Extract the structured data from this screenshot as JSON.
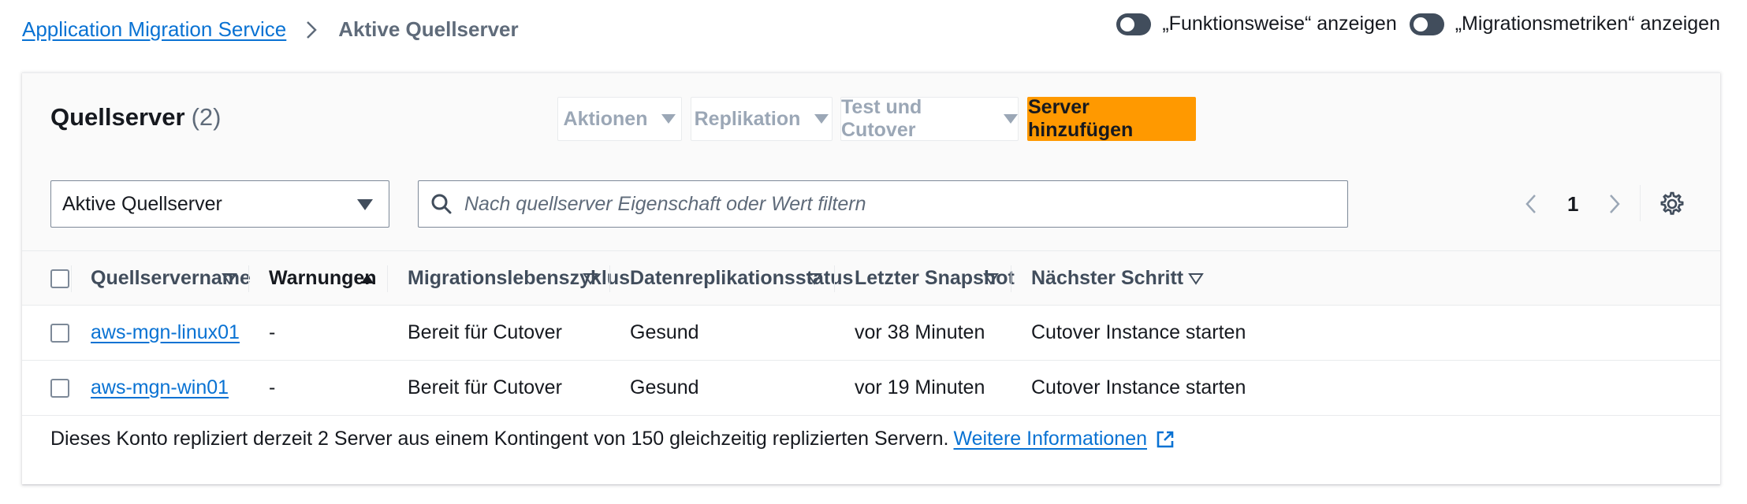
{
  "breadcrumb": {
    "root": "Application Migration Service",
    "current": "Aktive Quellserver"
  },
  "toggles": [
    {
      "label": "„Funktionsweise“ anzeigen",
      "on": false
    },
    {
      "label": "„Migrationsmetriken“ anzeigen",
      "on": false
    }
  ],
  "panel": {
    "title": "Quellserver",
    "count": "(2)"
  },
  "buttons": {
    "actions": "Aktionen",
    "replication": "Replikation",
    "test_cutover": "Test und Cutover",
    "add_server": "Server hinzufügen"
  },
  "filter": {
    "selected": "Aktive Quellserver",
    "search_placeholder": "Nach quellserver Eigenschaft oder Wert filtern"
  },
  "pagination": {
    "current_page": "1"
  },
  "table": {
    "columns": [
      "Quellservername",
      "Warnungen",
      "Migrationslebenszyklus",
      "Datenreplikationsstatus",
      "Letzter Snapshot",
      "Nächster Schritt"
    ],
    "rows": [
      {
        "name": "aws-mgn-linux01",
        "warnings": "-",
        "lifecycle": "Bereit für Cutover",
        "replication": "Gesund",
        "snapshot": "vor 38 Minuten",
        "next_step": "Cutover Instance starten"
      },
      {
        "name": "aws-mgn-win01",
        "warnings": "-",
        "lifecycle": "Bereit für Cutover",
        "replication": "Gesund",
        "snapshot": "vor 19 Minuten",
        "next_step": "Cutover Instance starten"
      }
    ]
  },
  "footer": {
    "text": "Dieses Konto repliziert derzeit 2 Server aus einem Kontingent von 150 gleichzeitig replizierten Servern.",
    "link": "Weitere Informationen"
  },
  "colors": {
    "primary_button": "#ff9900",
    "link": "#0972d3",
    "toggle_off": "#414d5c"
  }
}
